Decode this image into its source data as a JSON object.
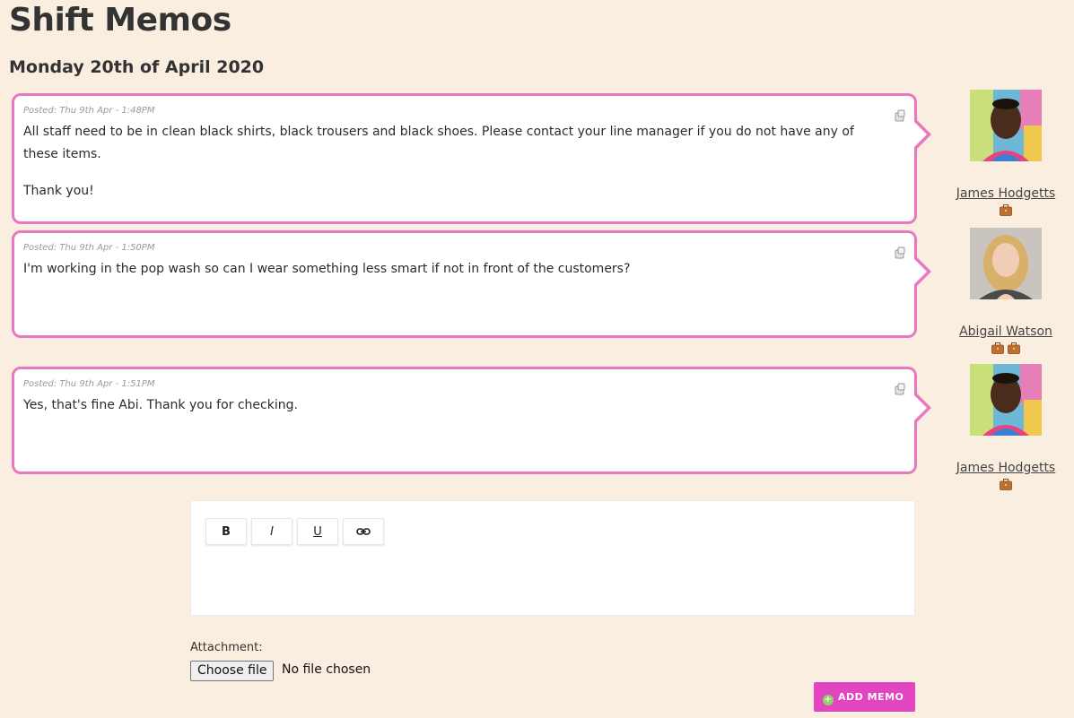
{
  "page": {
    "title": "Shift Memos",
    "date": "Monday 20th of April 2020"
  },
  "memos": [
    {
      "posted": "Posted: Thu 9th Apr - 1:48PM",
      "paragraphs": [
        "All staff need to be in clean black shirts, black trousers and black shoes. Please contact your line manager if you do not have any of these items.",
        "Thank you!"
      ],
      "author": "James Hodgetts",
      "badge_count": 1
    },
    {
      "posted": "Posted: Thu 9th Apr - 1:50PM",
      "paragraphs": [
        "I'm working in the pop wash so can I wear something less smart if not in front of the customers?"
      ],
      "author": "Abigail Watson",
      "badge_count": 2
    },
    {
      "posted": "Posted: Thu 9th Apr - 1:51PM",
      "paragraphs": [
        "Yes, that's fine Abi. Thank you for checking."
      ],
      "author": "James Hodgetts",
      "badge_count": 1
    }
  ],
  "editor": {
    "toolbar": {
      "bold": "B",
      "italic": "I",
      "underline": "U",
      "link_icon": "link-icon"
    }
  },
  "attachment": {
    "label": "Attachment:",
    "button": "Choose file",
    "status": "No file chosen"
  },
  "actions": {
    "add_memo": "ADD MEMO"
  },
  "colors": {
    "background": "#faeee0",
    "memo_border": "#e879c0",
    "add_button": "#e344bf",
    "badge": "#c0702e"
  }
}
